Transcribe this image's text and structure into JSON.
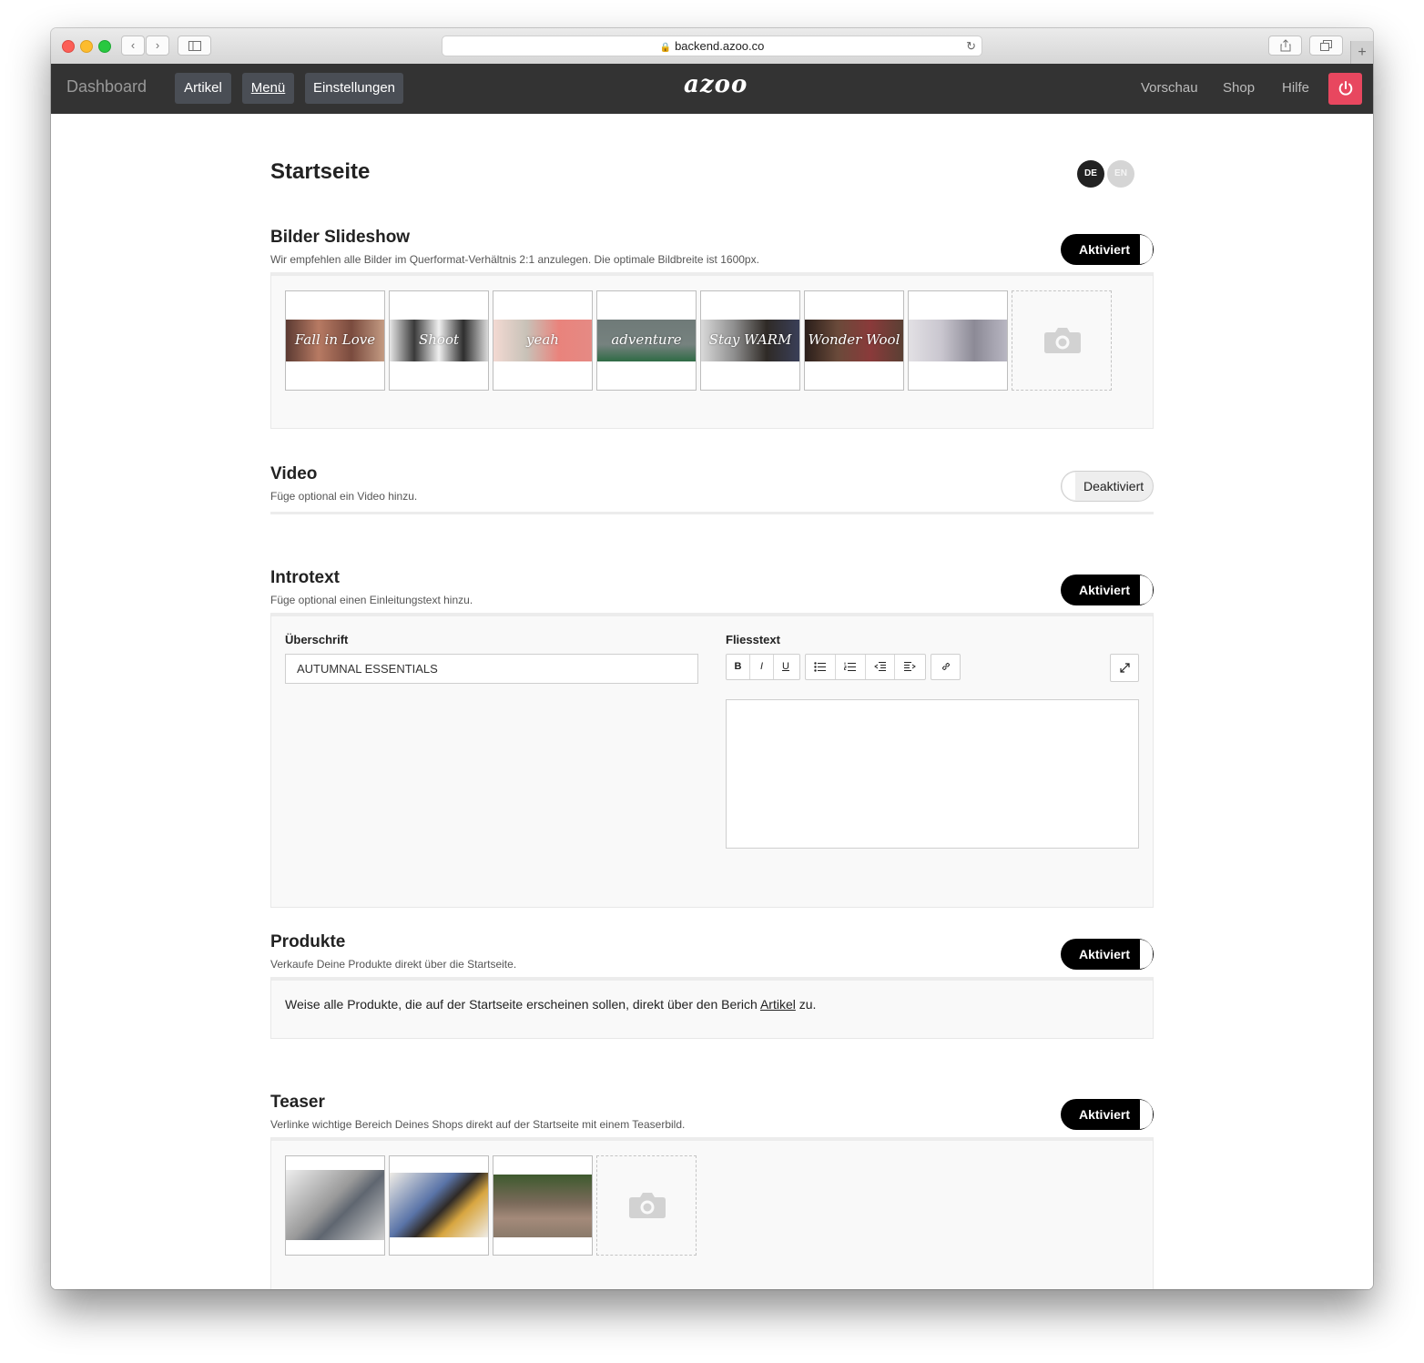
{
  "browser": {
    "url": "backend.azoo.co"
  },
  "nav": {
    "dashboard": "Dashboard",
    "items": [
      "Artikel",
      "Menü",
      "Einstellungen"
    ],
    "logo": "azoo",
    "right": [
      "Vorschau",
      "Shop",
      "Hilfe"
    ]
  },
  "page": {
    "title": "Startseite",
    "languages": [
      "DE",
      "EN"
    ],
    "active_language": "DE"
  },
  "sections": {
    "slideshow": {
      "title": "Bilder Slideshow",
      "description": "Wir empfehlen alle Bilder im Querformat-Verhältnis 2:1 anzulegen. Die optimale Bildbreite ist 1600px.",
      "toggle": "Aktiviert",
      "images": [
        {
          "caption": "Fall in Love",
          "color": "#8a5a4a"
        },
        {
          "caption": "Shoot",
          "color": "#9b9b9b"
        },
        {
          "caption": "yeah",
          "color": "#e58a84"
        },
        {
          "caption": "adventure",
          "color": "#6f7a78"
        },
        {
          "caption": "Stay WARM",
          "color": "#55524c"
        },
        {
          "caption": "Wonder Wool",
          "color": "#6a4a3a"
        },
        {
          "caption": "",
          "color": "#b8b6c2"
        }
      ]
    },
    "video": {
      "title": "Video",
      "description": "Füge optional ein Video hinzu.",
      "toggle": "Deaktiviert"
    },
    "introtext": {
      "title": "Introtext",
      "description": "Füge optional einen Einleitungstext hinzu.",
      "toggle": "Aktiviert",
      "heading_label": "Überschrift",
      "heading_value": "AUTUMNAL ESSENTIALS",
      "body_label": "Fliesstext",
      "toolbar": [
        "B",
        "I",
        "U"
      ]
    },
    "produkte": {
      "title": "Produkte",
      "description": "Verkaufe Deine Produkte direkt über die Startseite.",
      "toggle": "Aktiviert",
      "info_before": "Weise alle Produkte, die auf der Startseite erscheinen sollen, direkt über den Berich ",
      "info_link": "Artikel",
      "info_after": " zu."
    },
    "teaser": {
      "title": "Teaser",
      "description": "Verlinke wichtige Bereich Deines Shops direkt auf der Startseite mit einem Teaserbild.",
      "toggle": "Aktiviert",
      "images": [
        {
          "color": "#a8a8a8"
        },
        {
          "color": "#5a74a8"
        },
        {
          "color": "#7a6a5a"
        }
      ]
    }
  },
  "colors": {
    "nav_bg": "#333333",
    "power_button": "#e8475f",
    "toggle_on": "#000000"
  }
}
